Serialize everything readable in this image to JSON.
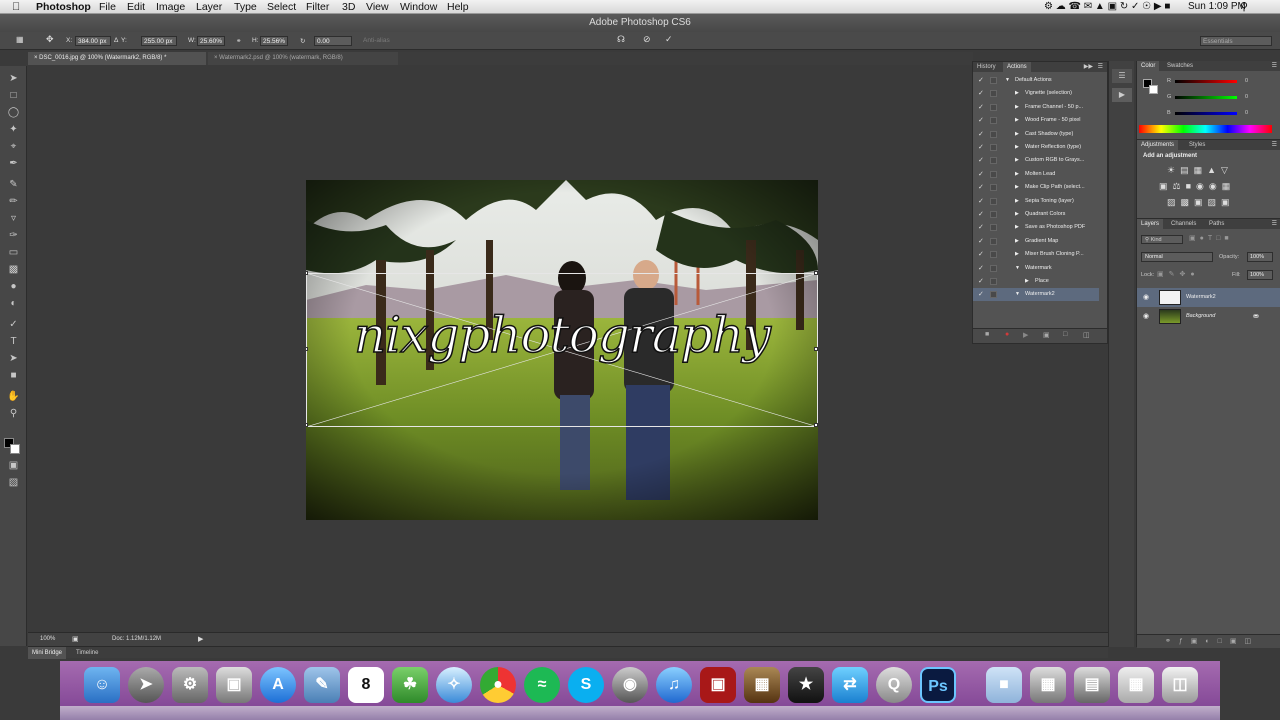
{
  "menubar": {
    "apple_icon": "apple-icon",
    "app_name": "Photoshop",
    "items": [
      "File",
      "Edit",
      "Image",
      "Layer",
      "Type",
      "Select",
      "Filter",
      "3D",
      "View",
      "Window",
      "Help"
    ],
    "clock": "Sun 1:09 PM"
  },
  "window": {
    "title": "Adobe Photoshop CS6"
  },
  "options": {
    "x_label": "X:",
    "x_value": "384.00 px",
    "y_label": "Y:",
    "y_value": "255.00 px",
    "w_label": "W:",
    "w_value": "25.60%",
    "h_label": "H:",
    "h_value": "25.56%",
    "angle_value": "0.00",
    "antialias_label": "Anti-alias",
    "workspace": "Essentials"
  },
  "doc_tabs": [
    {
      "label": "DSC_0016.jpg @ 100% (Watermark2, RGB/8) *"
    },
    {
      "label": "Watermark2.psd @ 100% (watermark, RGB/8)"
    }
  ],
  "canvas": {
    "watermark_text": "nixgphotography"
  },
  "status": {
    "zoom": "100%",
    "doc": "Doc: 1.12M/1.12M"
  },
  "bottom_tabs": [
    "Mini Bridge",
    "Timeline"
  ],
  "history_panel": {
    "tabs": [
      "History",
      "Actions"
    ],
    "actions": [
      {
        "label": "Default Actions",
        "level": 0
      },
      {
        "label": "Vignette (selection)",
        "level": 1
      },
      {
        "label": "Frame Channel - 50 p...",
        "level": 1
      },
      {
        "label": "Wood Frame - 50 pixel",
        "level": 1
      },
      {
        "label": "Cast Shadow (type)",
        "level": 1
      },
      {
        "label": "Water Reflection (type)",
        "level": 1
      },
      {
        "label": "Custom RGB to Grays...",
        "level": 1
      },
      {
        "label": "Molten Lead",
        "level": 1
      },
      {
        "label": "Make Clip Path (select...",
        "level": 1
      },
      {
        "label": "Sepia Toning (layer)",
        "level": 1
      },
      {
        "label": "Quadrant Colors",
        "level": 1
      },
      {
        "label": "Save as Photoshop PDF",
        "level": 1
      },
      {
        "label": "Gradient Map",
        "level": 1
      },
      {
        "label": "Mixer Brush Cloning P...",
        "level": 1
      },
      {
        "label": "Watermark",
        "level": 1
      },
      {
        "label": "Place",
        "level": 2
      },
      {
        "label": "Watermark2",
        "level": 1
      }
    ]
  },
  "color_panel": {
    "tabs": [
      "Color",
      "Swatches"
    ],
    "r_label": "R",
    "r_value": "0",
    "g_label": "G",
    "g_value": "0",
    "b_label": "B",
    "b_value": "0"
  },
  "adjustments_panel": {
    "tabs": [
      "Adjustments",
      "Styles"
    ],
    "heading": "Add an adjustment"
  },
  "layers_panel": {
    "tabs": [
      "Layers",
      "Channels",
      "Paths"
    ],
    "kind_label": "Kind",
    "blend_mode": "Normal",
    "opacity_label": "Opacity:",
    "opacity_value": "100%",
    "lock_label": "Lock:",
    "fill_label": "Fill:",
    "fill_value": "100%",
    "layers": [
      {
        "name": "Watermark2",
        "selected": true
      },
      {
        "name": "Background",
        "selected": false
      }
    ]
  },
  "dock": {
    "calendar_day": "8",
    "ps_label": "Ps"
  },
  "colors": {
    "accent_selected": "#5d6a7e",
    "record_red": "#d23a3a"
  }
}
